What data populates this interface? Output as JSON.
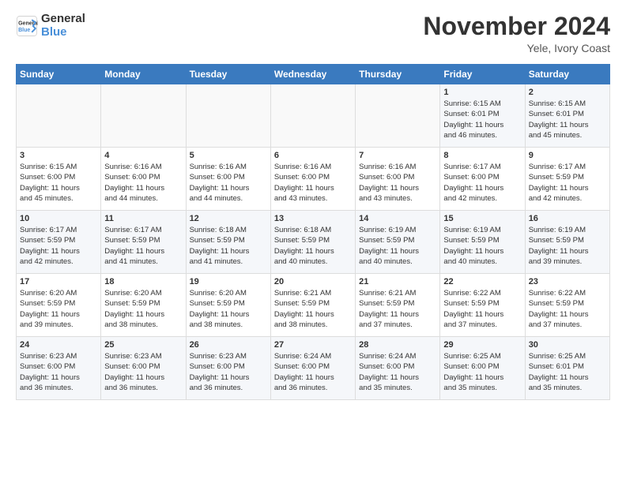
{
  "header": {
    "logo_line1": "General",
    "logo_line2": "Blue",
    "month": "November 2024",
    "location": "Yele, Ivory Coast"
  },
  "weekdays": [
    "Sunday",
    "Monday",
    "Tuesday",
    "Wednesday",
    "Thursday",
    "Friday",
    "Saturday"
  ],
  "weeks": [
    [
      {
        "day": "",
        "info": ""
      },
      {
        "day": "",
        "info": ""
      },
      {
        "day": "",
        "info": ""
      },
      {
        "day": "",
        "info": ""
      },
      {
        "day": "",
        "info": ""
      },
      {
        "day": "1",
        "info": "Sunrise: 6:15 AM\nSunset: 6:01 PM\nDaylight: 11 hours\nand 46 minutes."
      },
      {
        "day": "2",
        "info": "Sunrise: 6:15 AM\nSunset: 6:01 PM\nDaylight: 11 hours\nand 45 minutes."
      }
    ],
    [
      {
        "day": "3",
        "info": "Sunrise: 6:15 AM\nSunset: 6:00 PM\nDaylight: 11 hours\nand 45 minutes."
      },
      {
        "day": "4",
        "info": "Sunrise: 6:16 AM\nSunset: 6:00 PM\nDaylight: 11 hours\nand 44 minutes."
      },
      {
        "day": "5",
        "info": "Sunrise: 6:16 AM\nSunset: 6:00 PM\nDaylight: 11 hours\nand 44 minutes."
      },
      {
        "day": "6",
        "info": "Sunrise: 6:16 AM\nSunset: 6:00 PM\nDaylight: 11 hours\nand 43 minutes."
      },
      {
        "day": "7",
        "info": "Sunrise: 6:16 AM\nSunset: 6:00 PM\nDaylight: 11 hours\nand 43 minutes."
      },
      {
        "day": "8",
        "info": "Sunrise: 6:17 AM\nSunset: 6:00 PM\nDaylight: 11 hours\nand 42 minutes."
      },
      {
        "day": "9",
        "info": "Sunrise: 6:17 AM\nSunset: 5:59 PM\nDaylight: 11 hours\nand 42 minutes."
      }
    ],
    [
      {
        "day": "10",
        "info": "Sunrise: 6:17 AM\nSunset: 5:59 PM\nDaylight: 11 hours\nand 42 minutes."
      },
      {
        "day": "11",
        "info": "Sunrise: 6:17 AM\nSunset: 5:59 PM\nDaylight: 11 hours\nand 41 minutes."
      },
      {
        "day": "12",
        "info": "Sunrise: 6:18 AM\nSunset: 5:59 PM\nDaylight: 11 hours\nand 41 minutes."
      },
      {
        "day": "13",
        "info": "Sunrise: 6:18 AM\nSunset: 5:59 PM\nDaylight: 11 hours\nand 40 minutes."
      },
      {
        "day": "14",
        "info": "Sunrise: 6:19 AM\nSunset: 5:59 PM\nDaylight: 11 hours\nand 40 minutes."
      },
      {
        "day": "15",
        "info": "Sunrise: 6:19 AM\nSunset: 5:59 PM\nDaylight: 11 hours\nand 40 minutes."
      },
      {
        "day": "16",
        "info": "Sunrise: 6:19 AM\nSunset: 5:59 PM\nDaylight: 11 hours\nand 39 minutes."
      }
    ],
    [
      {
        "day": "17",
        "info": "Sunrise: 6:20 AM\nSunset: 5:59 PM\nDaylight: 11 hours\nand 39 minutes."
      },
      {
        "day": "18",
        "info": "Sunrise: 6:20 AM\nSunset: 5:59 PM\nDaylight: 11 hours\nand 38 minutes."
      },
      {
        "day": "19",
        "info": "Sunrise: 6:20 AM\nSunset: 5:59 PM\nDaylight: 11 hours\nand 38 minutes."
      },
      {
        "day": "20",
        "info": "Sunrise: 6:21 AM\nSunset: 5:59 PM\nDaylight: 11 hours\nand 38 minutes."
      },
      {
        "day": "21",
        "info": "Sunrise: 6:21 AM\nSunset: 5:59 PM\nDaylight: 11 hours\nand 37 minutes."
      },
      {
        "day": "22",
        "info": "Sunrise: 6:22 AM\nSunset: 5:59 PM\nDaylight: 11 hours\nand 37 minutes."
      },
      {
        "day": "23",
        "info": "Sunrise: 6:22 AM\nSunset: 5:59 PM\nDaylight: 11 hours\nand 37 minutes."
      }
    ],
    [
      {
        "day": "24",
        "info": "Sunrise: 6:23 AM\nSunset: 6:00 PM\nDaylight: 11 hours\nand 36 minutes."
      },
      {
        "day": "25",
        "info": "Sunrise: 6:23 AM\nSunset: 6:00 PM\nDaylight: 11 hours\nand 36 minutes."
      },
      {
        "day": "26",
        "info": "Sunrise: 6:23 AM\nSunset: 6:00 PM\nDaylight: 11 hours\nand 36 minutes."
      },
      {
        "day": "27",
        "info": "Sunrise: 6:24 AM\nSunset: 6:00 PM\nDaylight: 11 hours\nand 36 minutes."
      },
      {
        "day": "28",
        "info": "Sunrise: 6:24 AM\nSunset: 6:00 PM\nDaylight: 11 hours\nand 35 minutes."
      },
      {
        "day": "29",
        "info": "Sunrise: 6:25 AM\nSunset: 6:00 PM\nDaylight: 11 hours\nand 35 minutes."
      },
      {
        "day": "30",
        "info": "Sunrise: 6:25 AM\nSunset: 6:01 PM\nDaylight: 11 hours\nand 35 minutes."
      }
    ]
  ]
}
